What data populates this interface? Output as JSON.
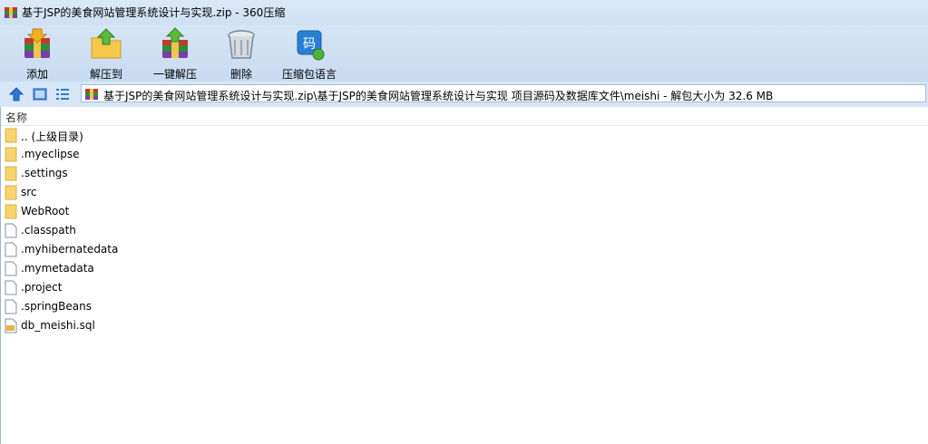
{
  "window": {
    "title": "基于JSP的美食网站管理系统设计与实现.zip - 360压缩",
    "app_icon": "archive-icon"
  },
  "toolbar": {
    "items": [
      {
        "label": "添加",
        "icon": "add-archive-icon"
      },
      {
        "label": "解压到",
        "icon": "extract-to-icon"
      },
      {
        "label": "一键解压",
        "icon": "one-click-extract-icon"
      },
      {
        "label": "删除",
        "icon": "trash-can-icon"
      },
      {
        "label": "压缩包语言",
        "icon": "archive-language-icon",
        "icon_text": "码"
      }
    ]
  },
  "navbar": {
    "icons": [
      "up-arrow-icon",
      "view-icons-icon",
      "view-list-icon"
    ],
    "address": "基于JSP的美食网站管理系统设计与实现.zip\\基于JSP的美食网站管理系统设计与实现 项目源码及数据库文件\\meishi - 解包大小为 32.6 MB"
  },
  "list": {
    "column_header": "名称",
    "items": [
      {
        "name": ".. (上级目录)",
        "type": "folder"
      },
      {
        "name": ".myeclipse",
        "type": "folder"
      },
      {
        "name": ".settings",
        "type": "folder"
      },
      {
        "name": "src",
        "type": "folder"
      },
      {
        "name": "WebRoot",
        "type": "folder"
      },
      {
        "name": ".classpath",
        "type": "file"
      },
      {
        "name": ".myhibernatedata",
        "type": "file"
      },
      {
        "name": ".mymetadata",
        "type": "file"
      },
      {
        "name": ".project",
        "type": "file"
      },
      {
        "name": ".springBeans",
        "type": "file"
      },
      {
        "name": "db_meishi.sql",
        "type": "sql"
      }
    ]
  },
  "colors": {
    "titlebar": "#dbe8f6",
    "toolbar": "#cfe0f3",
    "folder": "#f7d56e",
    "nav_accent": "#2b78d6"
  }
}
